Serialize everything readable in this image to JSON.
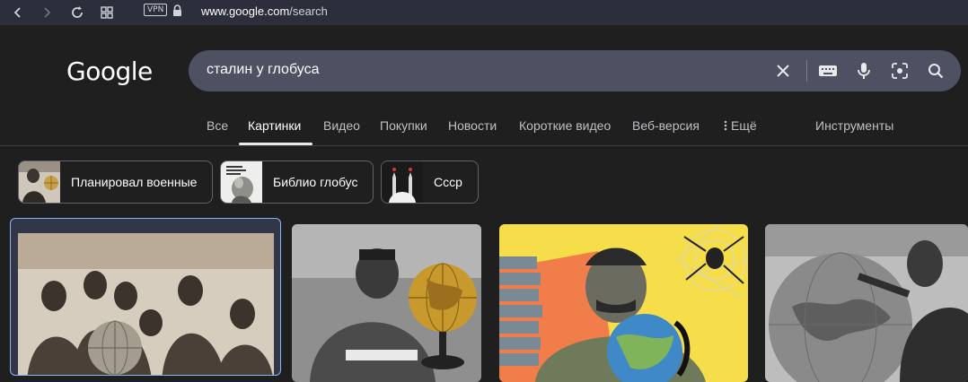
{
  "browser": {
    "vpn_label": "VPN",
    "url_host": "www.google.com",
    "url_path": "/search"
  },
  "logo": "Google",
  "search": {
    "query": "сталин у глобуса"
  },
  "tabs": [
    {
      "label": "Все"
    },
    {
      "label": "Картинки",
      "active": true
    },
    {
      "label": "Видео"
    },
    {
      "label": "Покупки"
    },
    {
      "label": "Новости"
    },
    {
      "label": "Короткие видео"
    },
    {
      "label": "Веб-версия"
    },
    {
      "label": "Ещё"
    },
    {
      "label": "Инструменты"
    }
  ],
  "chips": [
    {
      "label": "Планировал военные"
    },
    {
      "label": "Библио глобус"
    },
    {
      "label": "Ссср"
    }
  ],
  "colors": {
    "background": "#1f1f1f",
    "browser_bar": "#2c2f3b",
    "searchbox": "#4d5161",
    "accent": "#8ab4f8",
    "poster_yellow": "#f5de4a",
    "poster_orange": "#f07d4a"
  },
  "icons": [
    "back-icon",
    "forward-icon",
    "reload-icon",
    "tabs-grid-icon",
    "lock-icon",
    "clear-icon",
    "keyboard-icon",
    "mic-icon",
    "lens-icon",
    "search-icon",
    "more-vert-icon"
  ]
}
